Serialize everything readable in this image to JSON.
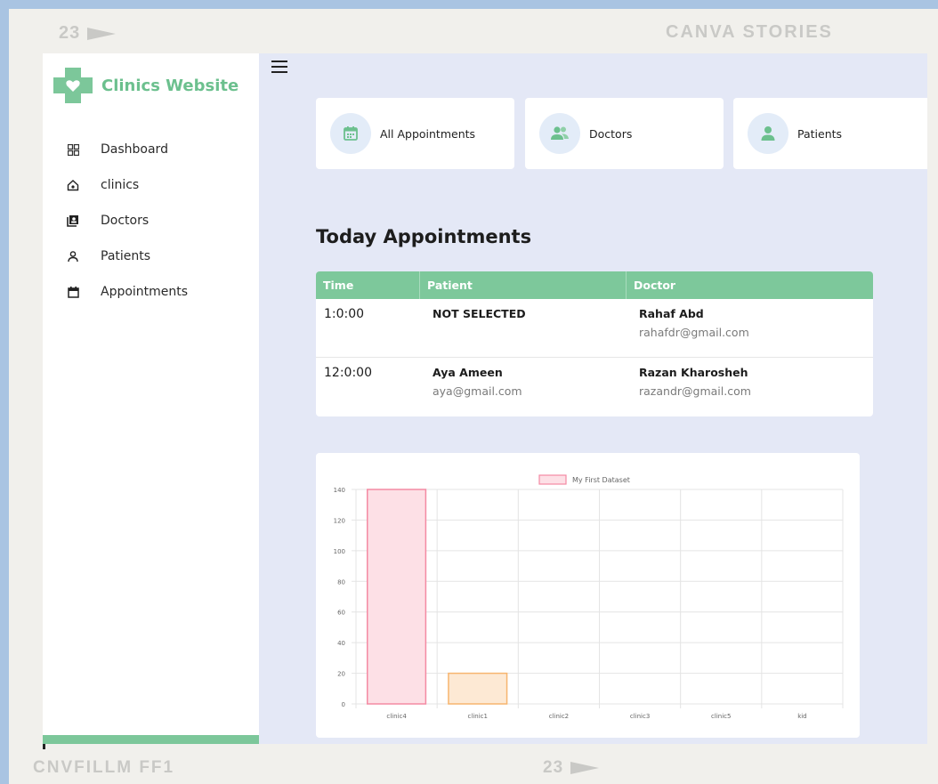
{
  "frame": {
    "top_number": "23",
    "top_brand": "CANVA STORIES",
    "bottom_left": "CNVFILLM FF1",
    "bottom_number": "23"
  },
  "sidebar": {
    "brand": "Clinics Website",
    "items": [
      {
        "label": "Dashboard",
        "icon": "dashboard-icon"
      },
      {
        "label": "clinics",
        "icon": "home-icon"
      },
      {
        "label": "Doctors",
        "icon": "contacts-icon"
      },
      {
        "label": "Patients",
        "icon": "person-icon"
      },
      {
        "label": "Appointments",
        "icon": "calendar-icon"
      }
    ]
  },
  "cards": [
    {
      "label": "All Appointments",
      "icon": "calendar-icon"
    },
    {
      "label": "Doctors",
      "icon": "users-icon"
    },
    {
      "label": "Patients",
      "icon": "user-icon"
    }
  ],
  "today": {
    "title": "Today Appointments",
    "columns": [
      "Time",
      "Patient",
      "Doctor"
    ],
    "rows": [
      {
        "time": "1:0:00",
        "patient": "NOT SELECTED",
        "patient_email": "",
        "doctor": "Rahaf Abd",
        "doctor_email": "rahafdr@gmail.com"
      },
      {
        "time": "12:0:00",
        "patient": "Aya Ameen",
        "patient_email": "aya@gmail.com",
        "doctor": "Razan Kharosheh",
        "doctor_email": "razandr@gmail.com"
      }
    ]
  },
  "colors": {
    "accent": "#7dc89b",
    "bar1_fill": "#fde0e6",
    "bar1_stroke": "#f48aa3",
    "bar2_fill": "#fde9d4",
    "bar2_stroke": "#f7b56f"
  },
  "chart_data": {
    "type": "bar",
    "categories": [
      "clinic4",
      "clinic1",
      "clinic2",
      "clinic3",
      "clinic5",
      "kid"
    ],
    "series": [
      {
        "name": "My First Dataset",
        "values": [
          140,
          20,
          0,
          0,
          0,
          0
        ]
      }
    ],
    "ylim": [
      0,
      140
    ],
    "yticks": [
      0,
      20,
      40,
      60,
      80,
      100,
      120,
      140
    ],
    "grid": true,
    "legend": "top"
  }
}
